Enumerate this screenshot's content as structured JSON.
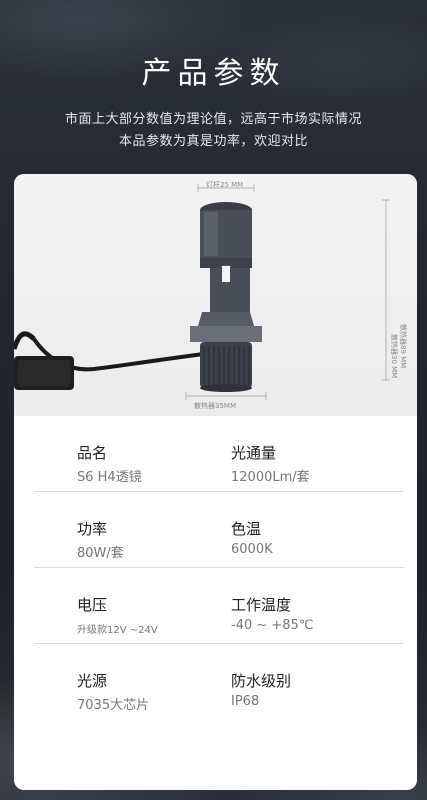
{
  "header": {
    "title": "产品参数",
    "subtitle_line1": "市面上大部分数值为理论值，远高于市场实际情况",
    "subtitle_line2": "本品参数为真是功率，欢迎对比"
  },
  "photo": {
    "dim_top": "灯杆25 MM",
    "dim_bottom": "散热器35MM",
    "dim_side": "散热器30 MM",
    "dim_side2": "散热器89 MM"
  },
  "specs": [
    {
      "left_label": "品名",
      "left_value": "S6 H4透镜",
      "right_label": "光通量",
      "right_value": "12000Lm/套"
    },
    {
      "left_label": "功率",
      "left_value": "80W/套",
      "right_label": "色温",
      "right_value": "6000K"
    },
    {
      "left_label": "电压",
      "left_value": "升级款12V ~24V",
      "right_label": "工作温度",
      "right_value": "-40 ~ +85℃"
    },
    {
      "left_label": "光源",
      "left_value": "7035大芯片",
      "right_label": "防水级别",
      "right_value": "IP68"
    }
  ]
}
